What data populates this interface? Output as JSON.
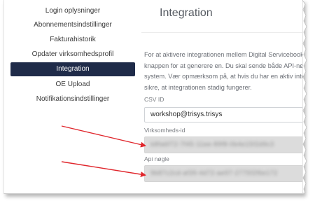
{
  "sidebar": {
    "items": [
      {
        "label": "Login oplysninger",
        "active": false
      },
      {
        "label": "Abonnementsindstillinger",
        "active": false
      },
      {
        "label": "Fakturahistorik",
        "active": false
      },
      {
        "label": "Opdater virksomhedsprofil",
        "active": false
      },
      {
        "label": "Integration",
        "active": true
      },
      {
        "label": "OE Upload",
        "active": false
      },
      {
        "label": "Notifikationsindstillinger",
        "active": false
      }
    ]
  },
  "main": {
    "title": "Integration",
    "intro_lines": [
      "For at aktivere integrationen mellem Digital Servicebook",
      "knappen for at generere en. Du skal sende både API-nø",
      "system. Vær opmærksom på, at hvis du har en aktiv inte",
      "sikre, at integrationen stadig fungerer."
    ],
    "csv_id": {
      "label": "CSV ID",
      "value": "workshop@trisys.trisys"
    },
    "virksomheds_id": {
      "label": "Virksomheds-id",
      "value": "b8fa6f72-7f45-11ee-89f8-0b4e15f2d9c3"
    },
    "api_key": {
      "label": "Api nøgle",
      "value": "9b87c2cd-af39-4d72-ae97-2775f2f6e172"
    }
  },
  "colors": {
    "active_nav_bg": "#1f2b49",
    "arrow": "#e0262c",
    "readonly_field_bg": "#dcdcdc"
  }
}
